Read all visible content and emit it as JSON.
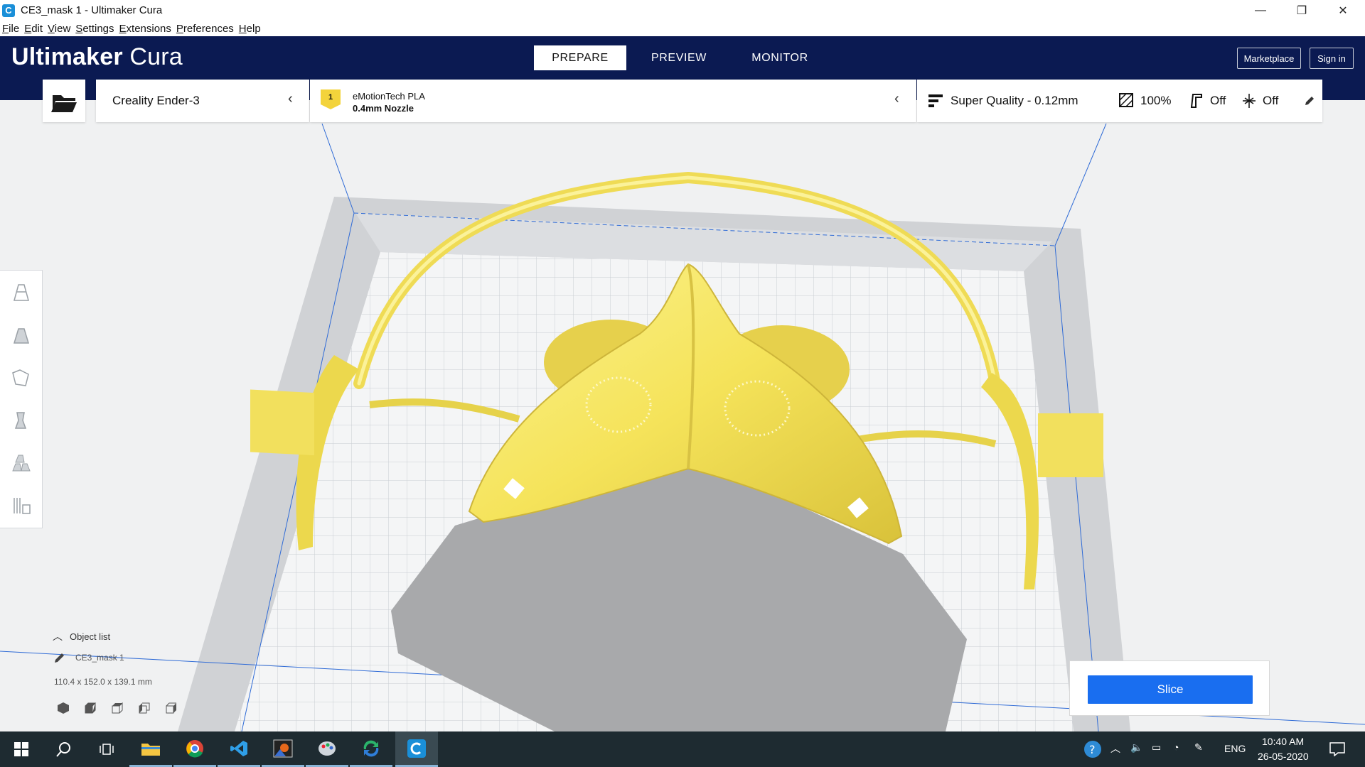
{
  "window": {
    "title": "CE3_mask 1 - Ultimaker Cura",
    "minimize": "—",
    "maximize": "❐",
    "close": "✕"
  },
  "menu": [
    "File",
    "Edit",
    "View",
    "Settings",
    "Extensions",
    "Preferences",
    "Help"
  ],
  "header": {
    "brand_bold": "Ultimaker",
    "brand_light": "Cura",
    "tabs": [
      {
        "label": "PREPARE",
        "active": true
      },
      {
        "label": "PREVIEW",
        "active": false
      },
      {
        "label": "MONITOR",
        "active": false
      }
    ],
    "marketplace": "Marketplace",
    "signin": "Sign in"
  },
  "config": {
    "printer": "Creality Ender-3",
    "extruder_number": "1",
    "material": "eMotionTech PLA",
    "nozzle": "0.4mm Nozzle",
    "quality": "Super Quality - 0.12mm",
    "infill": "100%",
    "support": "Off",
    "adhesion": "Off"
  },
  "object_list": {
    "label": "Object list",
    "item": "CE3_mask 1",
    "dimensions": "110.4 x 152.0 x 139.1 mm"
  },
  "slice": {
    "label": "Slice"
  },
  "taskbar": {
    "time": "10:40 AM",
    "date": "26-05-2020",
    "language": "ENG"
  },
  "colors": {
    "header": "#0b1a52",
    "slice_button": "#196ef0",
    "model": "#f7e96b",
    "taskbar": "#1e2b31"
  }
}
